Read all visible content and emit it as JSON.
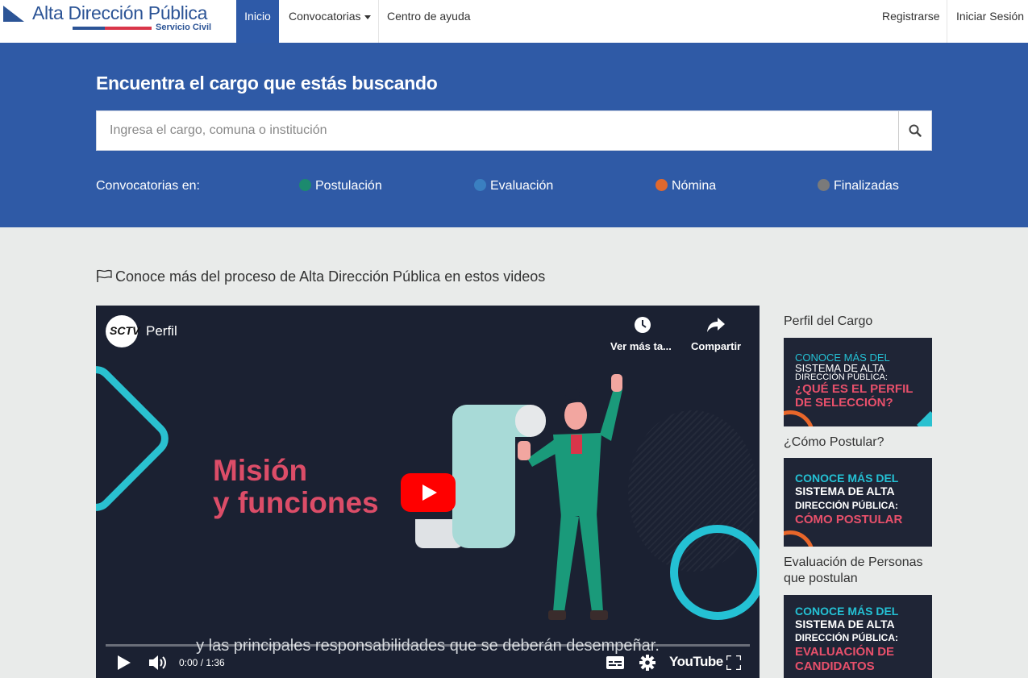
{
  "brand": {
    "name": "Alta Dirección Pública",
    "subtitle": "Servicio Civil"
  },
  "nav": {
    "inicio": "Inicio",
    "convocatorias": "Convocatorias",
    "ayuda": "Centro de ayuda",
    "registrarse": "Registrarse",
    "login": "Iniciar Sesión"
  },
  "hero": {
    "title": "Encuentra el cargo que estás buscando",
    "search_placeholder": "Ingresa el cargo, comuna o institución",
    "status_label": "Convocatorias en:",
    "statuses": [
      {
        "label": "Postulación",
        "color": "#1c8a6e"
      },
      {
        "label": "Evaluación",
        "color": "#3a7fc0"
      },
      {
        "label": "Nómina",
        "color": "#e0682d"
      },
      {
        "label": "Finalizadas",
        "color": "#7a7a7a"
      }
    ]
  },
  "videos_section": {
    "title": "Conoce más del proceso de Alta Dirección Pública en estos videos"
  },
  "player": {
    "channel_logo": "SCTV",
    "title": "Perfil",
    "watch_later": "Ver más ta...",
    "share": "Compartir",
    "slide_line1": "Misión",
    "slide_line2": "y funciones",
    "caption": "y las principales responsabilidades que se deberán desempeñar.",
    "time": "0:00 / 1:36",
    "youtube_label": "YouTube",
    "progress": 0
  },
  "sidebar": {
    "items": [
      {
        "title": "Perfil del Cargo",
        "thumb_lines": [
          "CONOCE MÁS DEL",
          "SISTEMA DE ALTA",
          "DIRECCIÓN PÚBLICA:",
          "¿QUÉ ES EL PERFIL",
          "DE SELECCIÓN?"
        ]
      },
      {
        "title": "¿Cómo Postular?",
        "thumb_lines": [
          "CONOCE MÁS DEL",
          "SISTEMA DE ALTA",
          "DIRECCIÓN PÚBLICA:",
          "CÓMO POSTULAR"
        ]
      },
      {
        "title": "Evaluación de Personas que postulan",
        "thumb_lines": [
          "CONOCE MÁS DEL",
          "SISTEMA DE ALTA",
          "DIRECCIÓN PÚBLICA:",
          "EVALUACIÓN DE",
          "CANDIDATOS"
        ]
      }
    ]
  }
}
